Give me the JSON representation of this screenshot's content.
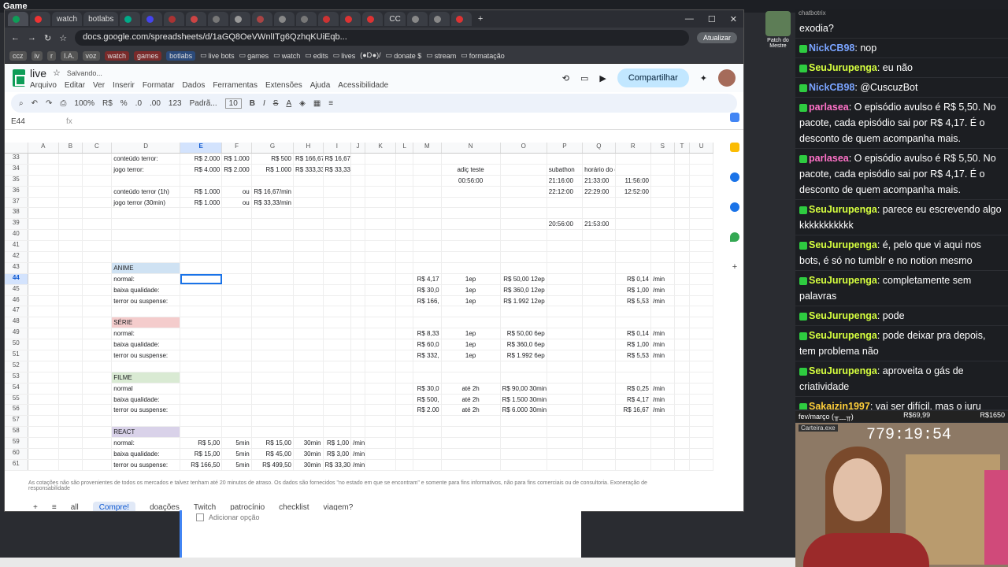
{
  "obs_title": "Game",
  "tabs": [
    "watch",
    "botlabs",
    "(",
    "S",
    "L",
    "(",
    "N",
    "C",
    "E",
    "A",
    "T",
    "C",
    "C",
    "N",
    "P",
    "N",
    "CC",
    "C",
    "C",
    "C",
    "N"
  ],
  "url": "docs.google.com/spreadsheets/d/1aGQ8OeVWnlITg6QzhqKUiEqb...",
  "update_label": "Atualizar",
  "bookmarks": {
    "chips": [
      "ccz",
      "iv",
      "r",
      "I.A.",
      "voz",
      "watch",
      "games",
      "botlabs"
    ],
    "links": [
      "live bots",
      "games",
      "watch",
      "edits",
      "lives",
      "(●Ɒ●)/",
      "donate $",
      "stream",
      "formatação"
    ]
  },
  "doc": {
    "name": "live",
    "saving": "Salvando...",
    "menus": [
      "Arquivo",
      "Editar",
      "Ver",
      "Inserir",
      "Formatar",
      "Dados",
      "Ferramentas",
      "Extensões",
      "Ajuda",
      "Acessibilidade"
    ],
    "share": "Compartilhar"
  },
  "toolbar": {
    "zoom": "100%",
    "currency": "R$",
    "percent": "%",
    "dec1": ".0",
    "dec2": ".00",
    "num": "123",
    "font": "Padrã...",
    "size": "10"
  },
  "formula": {
    "cellref": "E44",
    "fx": "fx"
  },
  "columns": [
    "A",
    "B",
    "C",
    "D",
    "E",
    "F",
    "G",
    "H",
    "I",
    "J",
    "K",
    "L",
    "M",
    "N",
    "O",
    "P",
    "Q",
    "R",
    "S",
    "T",
    "U"
  ],
  "rows": [
    {
      "n": "33",
      "D": "conteúdo terror:",
      "E": "R$ 2.000",
      "F": "R$ 1.000",
      "G": "R$ 500",
      "H": "R$ 166,67",
      "I": "R$ 16,67"
    },
    {
      "n": "34",
      "D": "jogo terror:",
      "E": "R$ 4.000",
      "F": "R$ 2.000",
      "G": "R$ 1.000",
      "H": "R$ 333,33",
      "I": "R$ 33,33",
      "N": "adiç teste",
      "P": "subathon",
      "Q": "horário do dia"
    },
    {
      "n": "35",
      "N": "00:56:00",
      "P": "21:16:00",
      "Q": "21:33:00",
      "R": "11:56:00"
    },
    {
      "n": "36",
      "D": "conteúdo terror (1h)",
      "E": "R$ 1.000",
      "F": "ou",
      "G": "R$ 16,67/min",
      "P": "22:12:00",
      "Q": "22:29:00",
      "R": "12:52:00"
    },
    {
      "n": "37",
      "D": "jogo terror (30min)",
      "E": "R$ 1.000",
      "F": "ou",
      "G": "R$ 33,33/min"
    },
    {
      "n": "38"
    },
    {
      "n": "39",
      "P": "20:56:00",
      "Q": "21:53:00"
    },
    {
      "n": "40"
    },
    {
      "n": "41"
    },
    {
      "n": "42"
    },
    {
      "n": "43",
      "D": "ANIME",
      "cls": "anime"
    },
    {
      "n": "44",
      "D": "normal:",
      "M": "R$ 4,17",
      "N": "1ep",
      "O": "R$ 50,00 12ep",
      "R": "R$ 0,14",
      "S": "/min"
    },
    {
      "n": "45",
      "D": "baixa qualidade:",
      "M": "R$ 30,0",
      "N": "1ep",
      "O": "R$ 360,0 12ep",
      "R": "R$ 1,00",
      "S": "/min"
    },
    {
      "n": "46",
      "D": "terror ou suspense:",
      "M": "R$ 166,",
      "N": "1ep",
      "O": "R$ 1.992 12ep",
      "R": "R$ 5,53",
      "S": "/min"
    },
    {
      "n": "47"
    },
    {
      "n": "48",
      "D": "SÉRIE",
      "cls": "serie"
    },
    {
      "n": "49",
      "D": "normal:",
      "M": "R$ 8,33",
      "N": "1ep",
      "O": "R$ 50,00 6ep",
      "R": "R$ 0,14",
      "S": "/min"
    },
    {
      "n": "50",
      "D": "baixa qualidade:",
      "M": "R$ 60,0",
      "N": "1ep",
      "O": "R$ 360,0 6ep",
      "R": "R$ 1,00",
      "S": "/min"
    },
    {
      "n": "51",
      "D": "terror ou suspense:",
      "M": "R$ 332,",
      "N": "1ep",
      "O": "R$ 1.992 6ep",
      "R": "R$ 5,53",
      "S": "/min"
    },
    {
      "n": "52"
    },
    {
      "n": "53",
      "D": "FILME",
      "cls": "filme"
    },
    {
      "n": "54",
      "D": "normal",
      "M": "R$ 30,0",
      "N": "até 2h",
      "O": "R$ 90,00 30min",
      "R": "R$ 0,25",
      "S": "/min"
    },
    {
      "n": "55",
      "D": "baixa qualidade:",
      "M": "R$ 500,",
      "N": "até 2h",
      "O": "R$ 1.500 30min",
      "R": "R$ 4,17",
      "S": "/min"
    },
    {
      "n": "56",
      "D": "terror ou suspense:",
      "M": "R$ 2.00",
      "N": "até 2h",
      "O": "R$ 6.000 30min",
      "R": "R$ 16,67",
      "S": "/min"
    },
    {
      "n": "57"
    },
    {
      "n": "58",
      "D": "REACT",
      "cls": "react"
    },
    {
      "n": "59",
      "D": "normal:",
      "E": "R$ 5,00",
      "F": "5min",
      "G": "R$ 15,00",
      "H": "30min",
      "I": "R$ 1,00",
      "J": "/min"
    },
    {
      "n": "60",
      "D": "baixa qualidade:",
      "E": "R$ 15,00",
      "F": "5min",
      "G": "R$ 45,00",
      "H": "30min",
      "I": "R$ 3,00",
      "J": "/min"
    },
    {
      "n": "61",
      "D": "terror ou suspense:",
      "E": "R$ 166,50",
      "F": "5min",
      "G": "R$ 499,50",
      "H": "30min",
      "I": "R$ 33,30",
      "J": "/min"
    }
  ],
  "disclaimer": "As cotações não são provenientes de todos os mercados e talvez tenham até 20 minutos de atraso. Os dados são fornecidos \"no estado em que se encontram\" e somente para fins informativos, não para fins comerciais ou de consultoria. Exoneração de responsabilidade",
  "sheet_tabs": [
    "all",
    "Compre!",
    "doações",
    "Twitch",
    "patrocínio",
    "checklist",
    "viagem?"
  ],
  "below_option": "Adicionar opção",
  "mascot_label": "Patch do Mestre",
  "chat": {
    "title": "chatbotrix",
    "messages": [
      {
        "user": "",
        "cls": "",
        "text": "exodia?"
      },
      {
        "user": "NickCB98",
        "cls": "u-nick",
        "text": ": nop"
      },
      {
        "user": "SeuJurupenga",
        "cls": "u-seu",
        "text": ": eu não"
      },
      {
        "user": "NickCB98",
        "cls": "u-nick",
        "text": ": @CuscuzBot"
      },
      {
        "user": "parlasea",
        "cls": "u-parla",
        "text": ": O episódio avulso é R$ 5,50. No pacote, cada episódio sai por R$ 4,17. É o desconto de quem acompanha mais."
      },
      {
        "user": "parlasea",
        "cls": "u-parla",
        "text": ": O episódio avulso é R$ 5,50. No pacote, cada episódio sai por R$ 4,17. É o desconto de quem acompanha mais."
      },
      {
        "user": "SeuJurupenga",
        "cls": "u-seu",
        "text": ": parece eu escrevendo algo kkkkkkkkkkk"
      },
      {
        "user": "SeuJurupenga",
        "cls": "u-seu",
        "text": ": é, pelo que vi aqui nos bots, é só no tumblr e no notion mesmo"
      },
      {
        "user": "SeuJurupenga",
        "cls": "u-seu",
        "text": ": completamente sem palavras"
      },
      {
        "user": "SeuJurupenga",
        "cls": "u-seu",
        "text": ": pode"
      },
      {
        "user": "SeuJurupenga",
        "cls": "u-seu",
        "text": ": pode deixar pra depois, tem problema não"
      },
      {
        "user": "SeuJurupenga",
        "cls": "u-seu",
        "text": ": aproveita o gás de criatividade"
      },
      {
        "user": "Sakaizin1997",
        "cls": "u-saka",
        "text": ": vai ser difícil, mas o juru aguenta deixar o vrum Vrum pra depois"
      }
    ]
  },
  "goal": {
    "label": "fev/março (╥﹏╥)",
    "value": "R$69,99",
    "amount": "R$1650"
  },
  "cam": {
    "label": "Carteira.exe",
    "timer": "779:19:54"
  }
}
